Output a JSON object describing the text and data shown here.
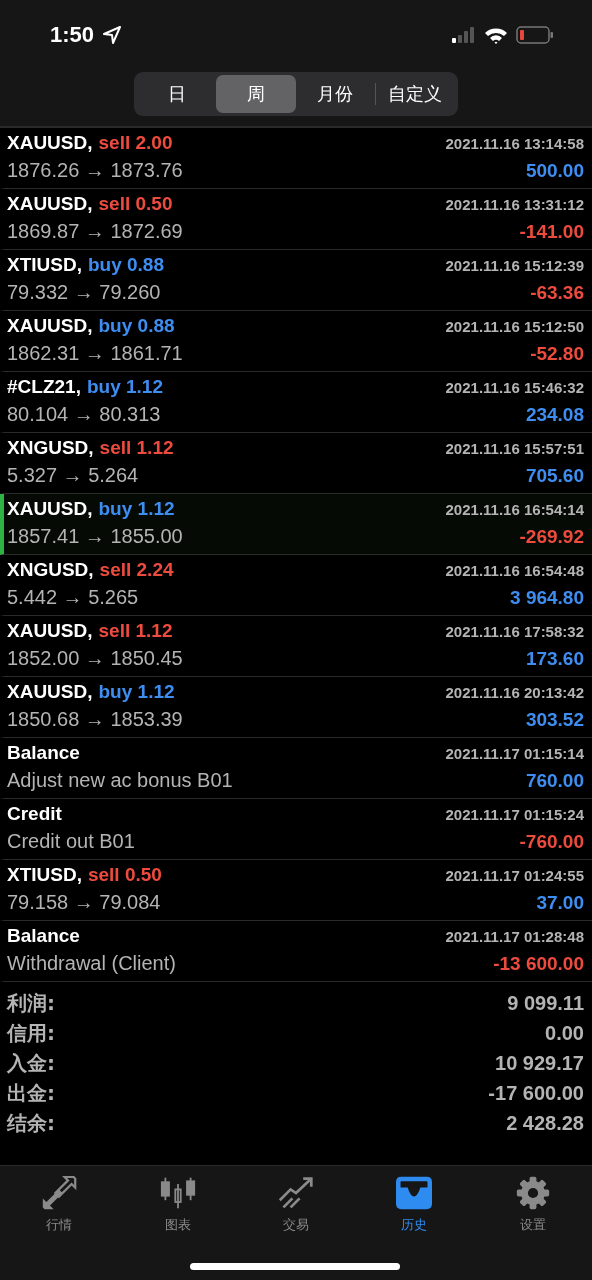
{
  "status_bar": {
    "time": "1:50"
  },
  "period_tabs": [
    {
      "label": "日",
      "selected": false
    },
    {
      "label": "周",
      "selected": true
    },
    {
      "label": "月份",
      "selected": false
    },
    {
      "label": "自定义",
      "selected": false
    }
  ],
  "deals": [
    {
      "kind": "trade",
      "symbol": "XAUUSD,",
      "side": "sell",
      "volume": "2.00",
      "time": "2021.11.16 13:14:58",
      "detail": "1876.26 → 1873.76",
      "profit": "500.00",
      "positive": true,
      "selected": false
    },
    {
      "kind": "trade",
      "symbol": "XAUUSD,",
      "side": "sell",
      "volume": "0.50",
      "time": "2021.11.16 13:31:12",
      "detail": "1869.87 → 1872.69",
      "profit": "-141.00",
      "positive": false,
      "selected": false
    },
    {
      "kind": "trade",
      "symbol": "XTIUSD,",
      "side": "buy",
      "volume": "0.88",
      "time": "2021.11.16 15:12:39",
      "detail": "79.332 → 79.260",
      "profit": "-63.36",
      "positive": false,
      "selected": false
    },
    {
      "kind": "trade",
      "symbol": "XAUUSD,",
      "side": "buy",
      "volume": "0.88",
      "time": "2021.11.16 15:12:50",
      "detail": "1862.31 → 1861.71",
      "profit": "-52.80",
      "positive": false,
      "selected": false
    },
    {
      "kind": "trade",
      "symbol": "#CLZ21,",
      "side": "buy",
      "volume": "1.12",
      "time": "2021.11.16 15:46:32",
      "detail": "80.104 → 80.313",
      "profit": "234.08",
      "positive": true,
      "selected": false
    },
    {
      "kind": "trade",
      "symbol": "XNGUSD,",
      "side": "sell",
      "volume": "1.12",
      "time": "2021.11.16 15:57:51",
      "detail": "5.327 → 5.264",
      "profit": "705.60",
      "positive": true,
      "selected": false
    },
    {
      "kind": "trade",
      "symbol": "XAUUSD,",
      "side": "buy",
      "volume": "1.12",
      "time": "2021.11.16 16:54:14",
      "detail": "1857.41 → 1855.00",
      "profit": "-269.92",
      "positive": false,
      "selected": true
    },
    {
      "kind": "trade",
      "symbol": "XNGUSD,",
      "side": "sell",
      "volume": "2.24",
      "time": "2021.11.16 16:54:48",
      "detail": "5.442 → 5.265",
      "profit": "3 964.80",
      "positive": true,
      "selected": false
    },
    {
      "kind": "trade",
      "symbol": "XAUUSD,",
      "side": "sell",
      "volume": "1.12",
      "time": "2021.11.16 17:58:32",
      "detail": "1852.00 → 1850.45",
      "profit": "173.60",
      "positive": true,
      "selected": false
    },
    {
      "kind": "trade",
      "symbol": "XAUUSD,",
      "side": "buy",
      "volume": "1.12",
      "time": "2021.11.16 20:13:42",
      "detail": "1850.68 → 1853.39",
      "profit": "303.52",
      "positive": true,
      "selected": false
    },
    {
      "kind": "balance",
      "symbol": "Balance",
      "time": "2021.11.17 01:15:14",
      "detail": "Adjust new ac bonus B01",
      "profit": "760.00",
      "positive": true,
      "selected": false
    },
    {
      "kind": "balance",
      "symbol": "Credit",
      "time": "2021.11.17 01:15:24",
      "detail": "Credit out B01",
      "profit": "-760.00",
      "positive": false,
      "selected": false
    },
    {
      "kind": "trade",
      "symbol": "XTIUSD,",
      "side": "sell",
      "volume": "0.50",
      "time": "2021.11.17 01:24:55",
      "detail": "79.158 → 79.084",
      "profit": "37.00",
      "positive": true,
      "selected": false
    },
    {
      "kind": "balance",
      "symbol": "Balance",
      "time": "2021.11.17 01:28:48",
      "detail": "Withdrawal (Client)",
      "profit": "-13 600.00",
      "positive": false,
      "selected": false
    }
  ],
  "summary": [
    {
      "label": "利润:",
      "value": "9 099.11"
    },
    {
      "label": "信用:",
      "value": "0.00"
    },
    {
      "label": "入金:",
      "value": "10 929.17"
    },
    {
      "label": "出金:",
      "value": "-17 600.00"
    },
    {
      "label": "结余:",
      "value": "2 428.28"
    }
  ],
  "bottom_nav": [
    {
      "kind": "arrows",
      "label": "行情",
      "selected": false
    },
    {
      "kind": "candles",
      "label": "图表",
      "selected": false
    },
    {
      "kind": "trend",
      "label": "交易",
      "selected": false
    },
    {
      "kind": "inbox",
      "label": "历史",
      "selected": true
    },
    {
      "kind": "gear",
      "label": "设置",
      "selected": false
    }
  ]
}
